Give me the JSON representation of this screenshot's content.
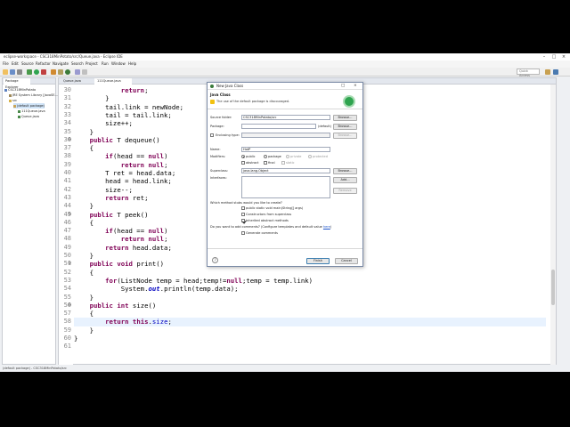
{
  "window": {
    "title": "eclipse-workspace - CSC318MinPotato/src/Queue.java - Eclipse IDE",
    "controls": [
      "–",
      "□",
      "×"
    ]
  },
  "menu": [
    "File",
    "Edit",
    "Source",
    "Refactor",
    "Navigate",
    "Search",
    "Project",
    "Run",
    "Window",
    "Help"
  ],
  "toolbar": {
    "quick_access_placeholder": "Quick Access"
  },
  "explorer": {
    "tab_label": "Package Explorer",
    "tree": [
      {
        "label": "CSC318MinPotato",
        "indent": 0,
        "icon": "project-icon",
        "selected": false
      },
      {
        "label": "JRE System Library [JavaSE-...]",
        "indent": 1,
        "icon": "library-icon",
        "selected": false
      },
      {
        "label": "src",
        "indent": 1,
        "icon": "folder-icon",
        "selected": false
      },
      {
        "label": "(default package)",
        "indent": 2,
        "icon": "package-icon",
        "selected": true
      },
      {
        "label": "111Queue.java",
        "indent": 3,
        "icon": "java-file-icon",
        "selected": false
      },
      {
        "label": "Queue.java",
        "indent": 3,
        "icon": "java-file-icon",
        "selected": false
      }
    ]
  },
  "editor": {
    "tabs": [
      {
        "label": "Queue.java",
        "active": false
      },
      {
        "label": "111Queue.java",
        "active": true
      }
    ],
    "lines": [
      {
        "num": "30",
        "text": "            return;",
        "fold": ""
      },
      {
        "num": "31",
        "text": "        }",
        "fold": ""
      },
      {
        "num": "32",
        "text": "        tail.link = newNode;",
        "fold": ""
      },
      {
        "num": "33",
        "text": "        tail = tail.link;",
        "fold": ""
      },
      {
        "num": "34",
        "text": "        size++;",
        "fold": ""
      },
      {
        "num": "35",
        "text": "    }",
        "fold": ""
      },
      {
        "num": "36",
        "text": "    public T dequeue()",
        "fold": "⊖"
      },
      {
        "num": "37",
        "text": "    {",
        "fold": ""
      },
      {
        "num": "38",
        "text": "        if(head == null)",
        "fold": ""
      },
      {
        "num": "39",
        "text": "            return null;",
        "fold": ""
      },
      {
        "num": "40",
        "text": "        T ret = head.data;",
        "fold": ""
      },
      {
        "num": "41",
        "text": "        head = head.link;",
        "fold": ""
      },
      {
        "num": "42",
        "text": "        size--;",
        "fold": ""
      },
      {
        "num": "43",
        "text": "        return ret;",
        "fold": ""
      },
      {
        "num": "44",
        "text": "    }",
        "fold": ""
      },
      {
        "num": "45",
        "text": "    public T peek()",
        "fold": "⊖"
      },
      {
        "num": "46",
        "text": "    {",
        "fold": ""
      },
      {
        "num": "47",
        "text": "        if(head == null)",
        "fold": ""
      },
      {
        "num": "48",
        "text": "            return null;",
        "fold": ""
      },
      {
        "num": "49",
        "text": "        return head.data;",
        "fold": ""
      },
      {
        "num": "50",
        "text": "    }",
        "fold": ""
      },
      {
        "num": "51",
        "text": "    public void print()",
        "fold": "⊖"
      },
      {
        "num": "52",
        "text": "    {",
        "fold": ""
      },
      {
        "num": "53",
        "text": "        for(ListNode temp = head;temp!=null;temp = temp.link)",
        "fold": ""
      },
      {
        "num": "54",
        "text": "            System.out.println(temp.data);",
        "fold": ""
      },
      {
        "num": "55",
        "text": "    }",
        "fold": ""
      },
      {
        "num": "56",
        "text": "    public int size()",
        "fold": "⊖"
      },
      {
        "num": "57",
        "text": "    {",
        "fold": ""
      },
      {
        "num": "58",
        "text": "        return this.size;",
        "fold": ""
      },
      {
        "num": "59",
        "text": "    }",
        "fold": ""
      },
      {
        "num": "60",
        "text": "}",
        "fold": ""
      },
      {
        "num": "61",
        "text": "",
        "fold": ""
      }
    ],
    "highlighted_line_index": 28
  },
  "status": {
    "text": "(default package) - CSC318MinPotato/src"
  },
  "dialog": {
    "title": "New Java Class",
    "header_title": "Java Class",
    "header_message": "The use of the default package is discouraged.",
    "source_folder_label": "Source folder:",
    "source_folder_value": "CSC318MinPotato/src",
    "package_label": "Package:",
    "package_value": "",
    "package_default": "(default)",
    "enclosing_label": "Enclosing type:",
    "name_label": "Name:",
    "name_value": "HotP",
    "modifiers_label": "Modifiers:",
    "modifiers_row1": [
      "public",
      "package",
      "private",
      "protected"
    ],
    "modifiers_row2": [
      "abstract",
      "final",
      "static"
    ],
    "superclass_label": "Superclass:",
    "superclass_value": "java.lang.Object",
    "interfaces_label": "Interfaces:",
    "browse": "Browse...",
    "add": "Add...",
    "remove": "Remove",
    "stubs_question": "Which method stubs would you like to create?",
    "stubs": [
      {
        "label": "public static void main(String[] args)",
        "checked": false
      },
      {
        "label": "Constructors from superclass",
        "checked": false
      },
      {
        "label": "Inherited abstract methods",
        "checked": true
      }
    ],
    "comments_question": "Do you want to add comments? (Configure templates and default value ",
    "comments_link": "here",
    "comments_suffix": ")",
    "generate_comments": "Generate comments",
    "help": "?",
    "finish": "Finish",
    "cancel": "Cancel"
  }
}
